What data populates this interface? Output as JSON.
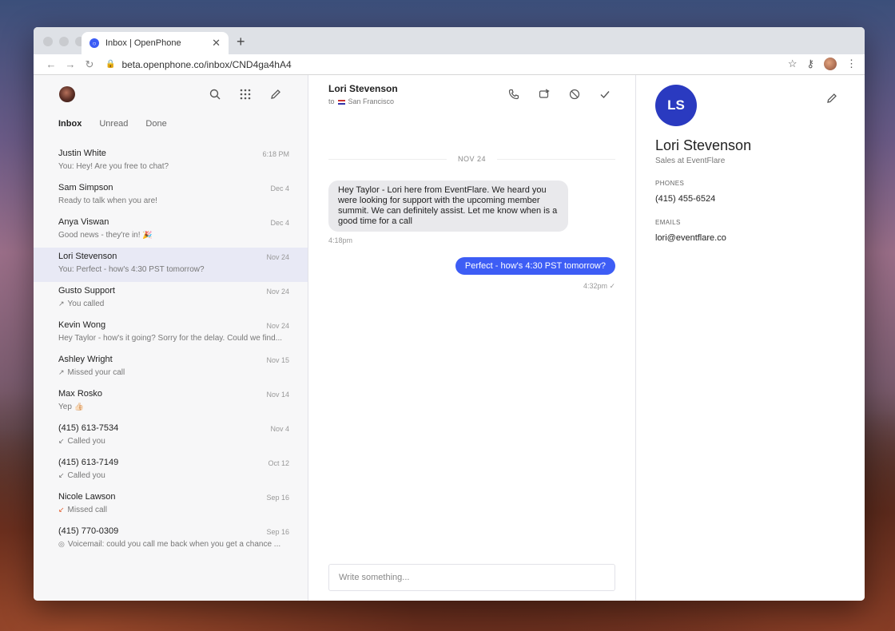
{
  "browser": {
    "tab_title": "Inbox | OpenPhone",
    "url": "beta.openphone.co/inbox/CND4ga4hA4"
  },
  "sidebar": {
    "filters": [
      {
        "label": "Inbox"
      },
      {
        "label": "Unread"
      },
      {
        "label": "Done"
      }
    ],
    "conversations": [
      {
        "name": "Justin White",
        "time": "6:18 PM",
        "preview": "You: Hey! Are you free to chat?"
      },
      {
        "name": "Sam Simpson",
        "time": "Dec 4",
        "preview": "Ready to talk when you are!"
      },
      {
        "name": "Anya Viswan",
        "time": "Dec 4",
        "preview": "Good news - they're in! 🎉"
      },
      {
        "name": "Lori Stevenson",
        "time": "Nov 24",
        "preview": "You: Perfect - how's 4:30 PST tomorrow?"
      },
      {
        "name": "Gusto Support",
        "time": "Nov 24",
        "preview": "You called"
      },
      {
        "name": "Kevin Wong",
        "time": "Nov 24",
        "preview": "Hey Taylor - how's it going? Sorry for the delay. Could we find..."
      },
      {
        "name": "Ashley Wright",
        "time": "Nov 15",
        "preview": "Missed your call"
      },
      {
        "name": "Max Rosko",
        "time": "Nov 14",
        "preview": "Yep 👍🏻"
      },
      {
        "name": "(415) 613-7534",
        "time": "Nov 4",
        "preview": "Called you"
      },
      {
        "name": "(415) 613-7149",
        "time": "Oct 12",
        "preview": "Called you"
      },
      {
        "name": "Nicole Lawson",
        "time": "Sep 16",
        "preview": "Missed call"
      },
      {
        "name": "(415) 770-0309",
        "time": "Sep 16",
        "preview": "Voicemail: could you call me back when you get a chance ..."
      }
    ]
  },
  "chat": {
    "contact_name": "Lori Stevenson",
    "to_prefix": "to",
    "location": "San Francisco",
    "date_separator": "NOV 24",
    "incoming_message": "Hey Taylor - Lori here from EventFlare. We heard you were looking for support with the upcoming member summit. We can definitely assist. Let me know when is a good time for a call",
    "incoming_time": "4:18pm",
    "outgoing_message": "Perfect - how's 4:30 PST tomorrow?",
    "outgoing_time": "4:32pm ✓",
    "compose_placeholder": "Write something..."
  },
  "details": {
    "initials": "LS",
    "name": "Lori Stevenson",
    "title": "Sales at EventFlare",
    "phones_label": "PHONES",
    "phone": "(415) 455-6524",
    "emails_label": "EMAILS",
    "email": "lori@eventflare.co"
  },
  "colors": {
    "accent": "#3d5df5",
    "avatar_bg": "#2a3ac0",
    "selected_row": "#e8e9f5",
    "missed": "#e25c2b"
  }
}
